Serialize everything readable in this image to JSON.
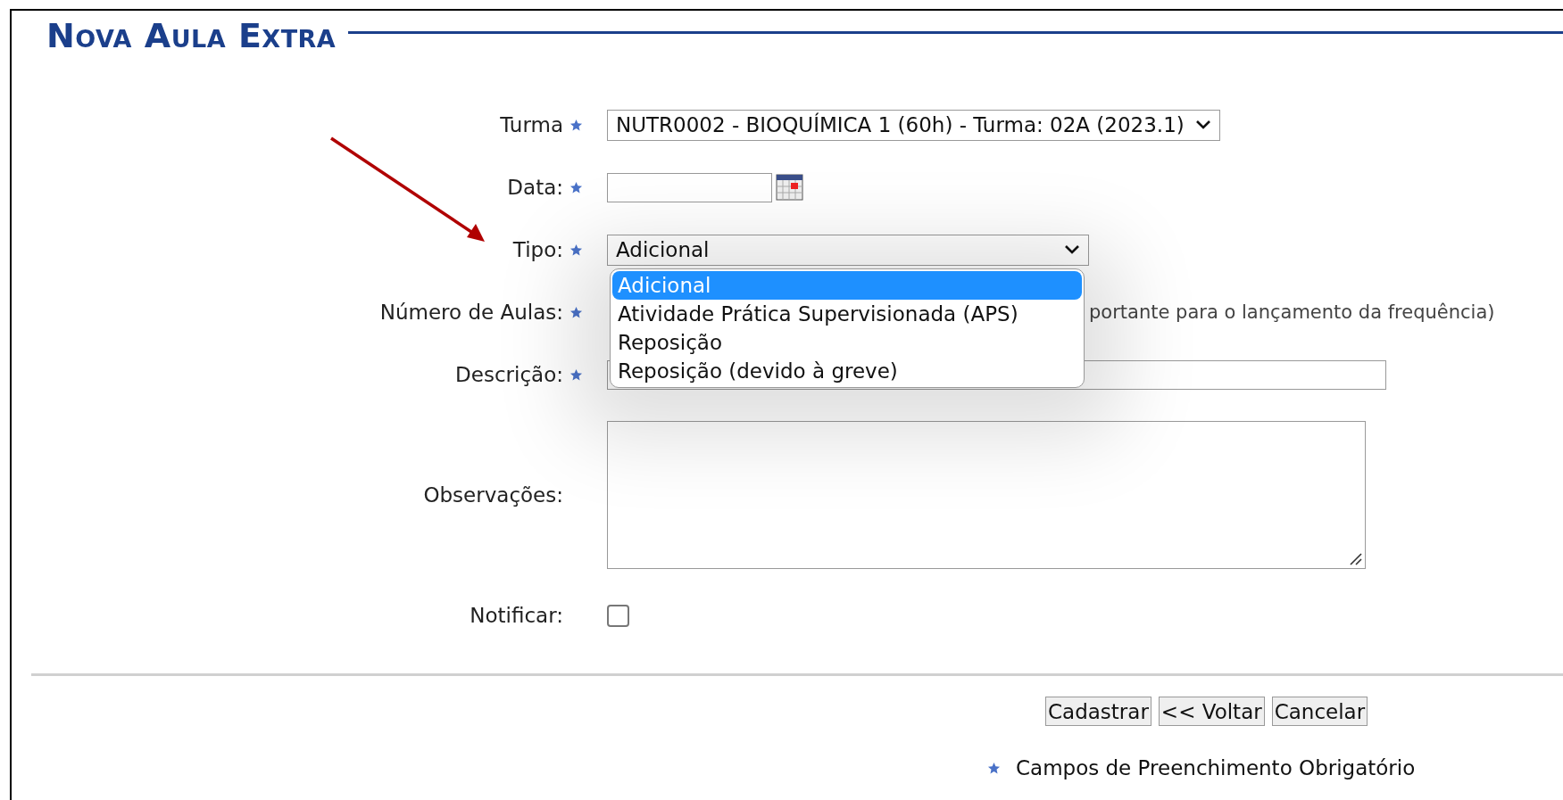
{
  "title": "Nova Aula Extra",
  "fields": [
    {
      "kind": "select",
      "label": "Turma",
      "required": true,
      "value": "NUTR0002 - BIOQUÍMICA 1 (60h) - Turma: 02A (2023.1)"
    },
    {
      "kind": "date",
      "label": "Data:",
      "required": true
    },
    {
      "kind": "select",
      "label": "Tipo:",
      "required": true,
      "value": "Adicional",
      "expanded": true,
      "options": [
        {
          "label": "Adicional",
          "selected": true
        },
        {
          "label": "Atividade Prática Supervisionada (APS)",
          "selected": false
        },
        {
          "label": "Reposição",
          "selected": false
        },
        {
          "label": "Reposição (devido à greve)",
          "selected": false
        }
      ]
    },
    {
      "kind": "number",
      "label": "Número de Aulas:",
      "required": true,
      "hint": "portante para o lançamento da frequência)"
    },
    {
      "kind": "text",
      "label": "Descrição:",
      "required": true
    },
    {
      "kind": "textarea",
      "label": "Observações:",
      "required": false
    },
    {
      "kind": "checkbox",
      "label": "Notificar:",
      "required": false,
      "checked": false
    }
  ],
  "buttons": [
    "Cadastrar",
    "<< Voltar",
    "Cancelar"
  ],
  "legend": "Campos de Preenchimento Obrigatório"
}
